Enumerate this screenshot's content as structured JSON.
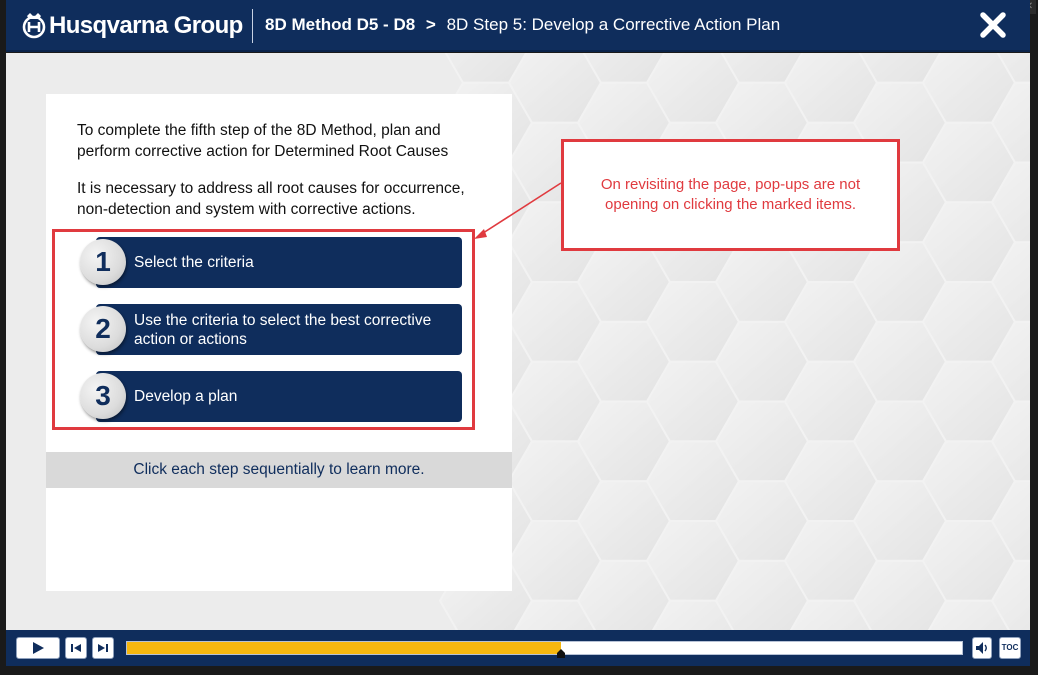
{
  "header": {
    "logo_text": "Husqvarna Group",
    "course": "8D Method D5 - D8",
    "separator": ">",
    "page_title": "8D Step 5: Develop a Corrective Action Plan"
  },
  "content": {
    "intro_1": "To complete the fifth step of the 8D Method, plan and perform corrective action for Determined Root Causes",
    "intro_2": "It is necessary to address all root causes for occurrence, non-detection and system with corrective actions.",
    "steps": [
      {
        "number": "1",
        "label": "Select the criteria"
      },
      {
        "number": "2",
        "label": "Use the criteria to select the best corrective action or actions"
      },
      {
        "number": "3",
        "label": "Develop a plan"
      }
    ],
    "instruction": "Click each step sequentially to learn more."
  },
  "annotation": {
    "callout_text": "On revisiting the page, pop-ups are not opening on clicking the marked items."
  },
  "player": {
    "progress": 0.52,
    "toc_label": "TOC"
  },
  "colors": {
    "brand_navy": "#0f2d5c",
    "annotation_red": "#e03a3f",
    "progress_fill": "#f6b70f",
    "stage_bg": "#ececec"
  },
  "icons": {
    "close": "close-x-icon",
    "play": "play-icon",
    "prev": "skip-back-icon",
    "next": "skip-forward-icon",
    "volume": "speaker-icon"
  }
}
